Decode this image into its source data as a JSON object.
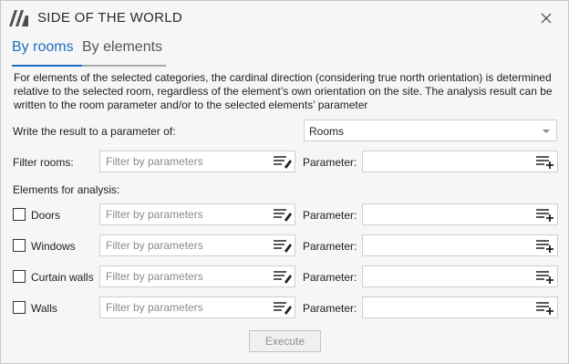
{
  "window": {
    "title": "SIDE OF THE WORLD"
  },
  "tabs": [
    {
      "label": "By rooms",
      "active": true
    },
    {
      "label": "By elements",
      "active": false
    }
  ],
  "description": "For elements of the selected categories, the cardinal direction (considering true north orientation) is determined relative to the selected room, regardless of the element’s own orientation on the site. The analysis result can be written to the room parameter and/or to the selected elements’ parameter",
  "write_result": {
    "label": "Write the result to a parameter of:",
    "selected": "Rooms"
  },
  "filter_rooms": {
    "label": "Filter rooms:",
    "placeholder": "Filter by parameters",
    "value": "",
    "parameter_label": "Parameter:",
    "parameter_value": ""
  },
  "elements_header": "Elements for analysis:",
  "elements": [
    {
      "label": "Doors",
      "checked": false,
      "placeholder": "Filter by parameters",
      "parameter_label": "Parameter:"
    },
    {
      "label": "Windows",
      "checked": false,
      "placeholder": "Filter by parameters",
      "parameter_label": "Parameter:"
    },
    {
      "label": "Curtain walls",
      "checked": false,
      "placeholder": "Filter by parameters",
      "parameter_label": "Parameter:"
    },
    {
      "label": "Walls",
      "checked": false,
      "placeholder": "Filter by parameters",
      "parameter_label": "Parameter:"
    }
  ],
  "execute_label": "Execute",
  "colors": {
    "accent": "#1f6fbf",
    "disabled_text": "#8f8f8f",
    "border": "#cfcfcf"
  }
}
